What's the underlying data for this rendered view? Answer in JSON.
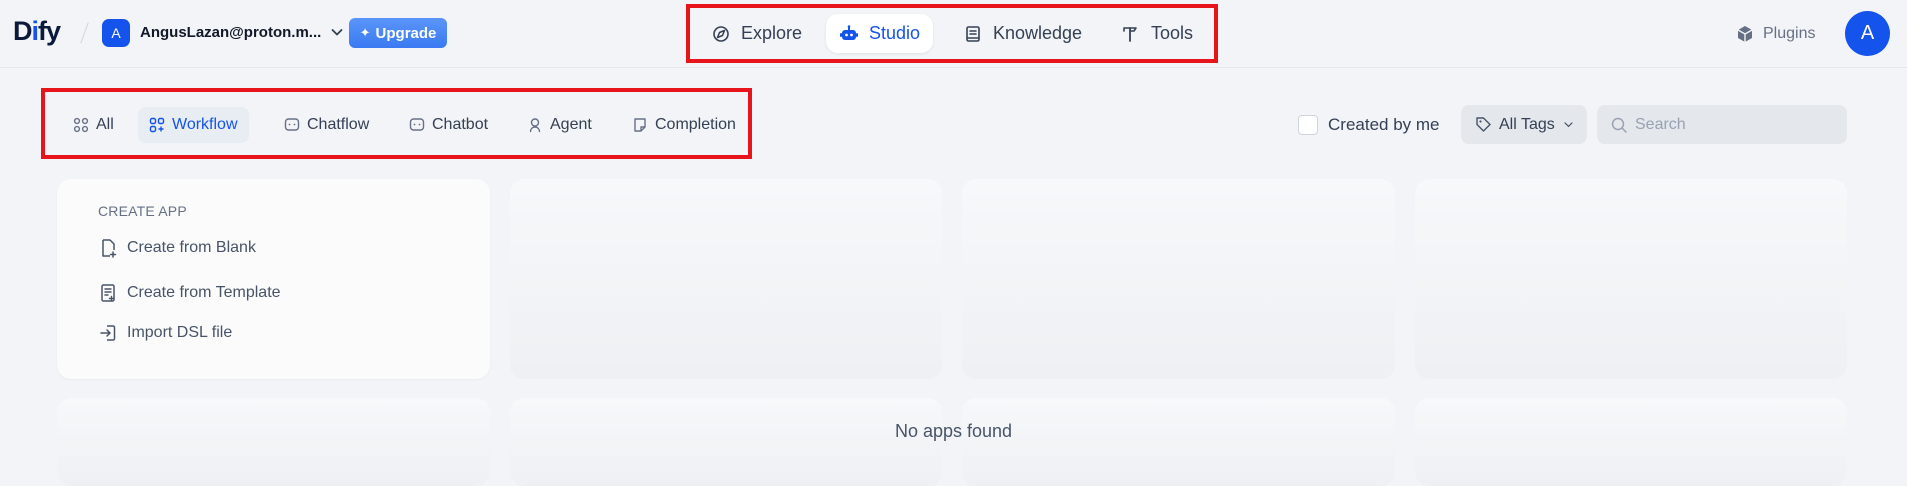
{
  "brand": {
    "logo_prefix": "D",
    "logo_i": "i",
    "logo_suffix": "fy"
  },
  "workspace": {
    "avatar_letter": "A",
    "name": "AngusLazan@proton.m...",
    "upgrade_label": "Upgrade"
  },
  "nav": {
    "items": [
      {
        "label": "Explore",
        "icon": "compass-icon",
        "active": false
      },
      {
        "label": "Studio",
        "icon": "robot-icon",
        "active": true
      },
      {
        "label": "Knowledge",
        "icon": "book-icon",
        "active": false
      },
      {
        "label": "Tools",
        "icon": "hammer-icon",
        "active": false
      }
    ]
  },
  "header_right": {
    "plugins_label": "Plugins",
    "user_avatar_letter": "A"
  },
  "filters": {
    "tabs": [
      {
        "label": "All",
        "icon": "grid-icon",
        "active": false
      },
      {
        "label": "Workflow",
        "icon": "workflow-icon",
        "active": true
      },
      {
        "label": "Chatflow",
        "icon": "chatflow-icon",
        "active": false
      },
      {
        "label": "Chatbot",
        "icon": "chatbot-icon",
        "active": false
      },
      {
        "label": "Agent",
        "icon": "agent-icon",
        "active": false
      },
      {
        "label": "Completion",
        "icon": "completion-icon",
        "active": false
      }
    ],
    "created_by_me_label": "Created by me",
    "created_by_me_checked": false,
    "tags_label": "All Tags",
    "search_placeholder": "Search"
  },
  "create_app": {
    "title": "CREATE APP",
    "items": [
      {
        "label": "Create from Blank",
        "icon": "new-file-icon"
      },
      {
        "label": "Create from Template",
        "icon": "template-icon"
      },
      {
        "label": "Import DSL file",
        "icon": "import-icon"
      }
    ]
  },
  "empty_state": {
    "message": "No apps found"
  },
  "colors": {
    "accent": "#1553ed",
    "highlight": "#e8141c",
    "background": "#f2f4f7"
  }
}
